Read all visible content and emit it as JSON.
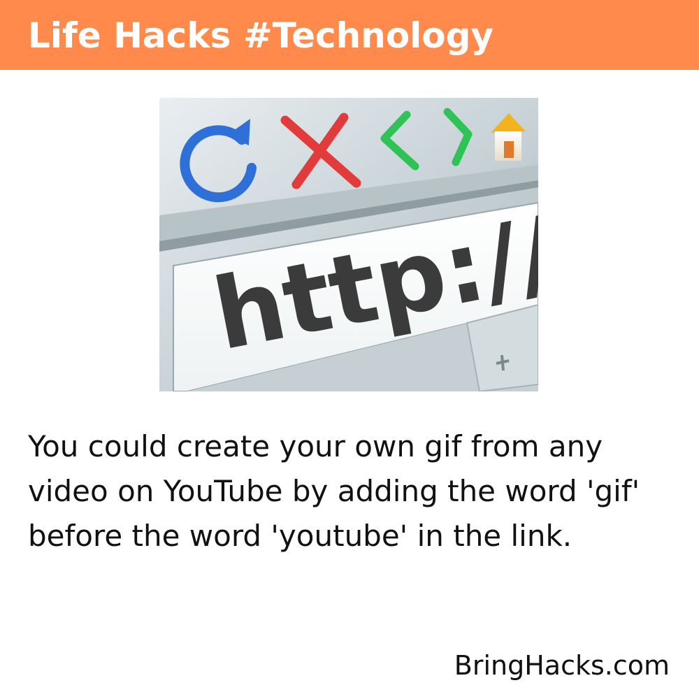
{
  "header": {
    "title": "Life Hacks #Technology",
    "background_color": "#ff8a4c"
  },
  "illustration": {
    "url_text": "http://ww",
    "icons": [
      "refresh-icon",
      "close-icon",
      "back-icon",
      "forward-icon",
      "home-icon",
      "plus-icon"
    ]
  },
  "tip": {
    "text": "You could create your own gif from any video on YouTube by adding the word 'gif' before the word 'youtube' in the link."
  },
  "footer": {
    "brand": "BringHacks.com"
  }
}
